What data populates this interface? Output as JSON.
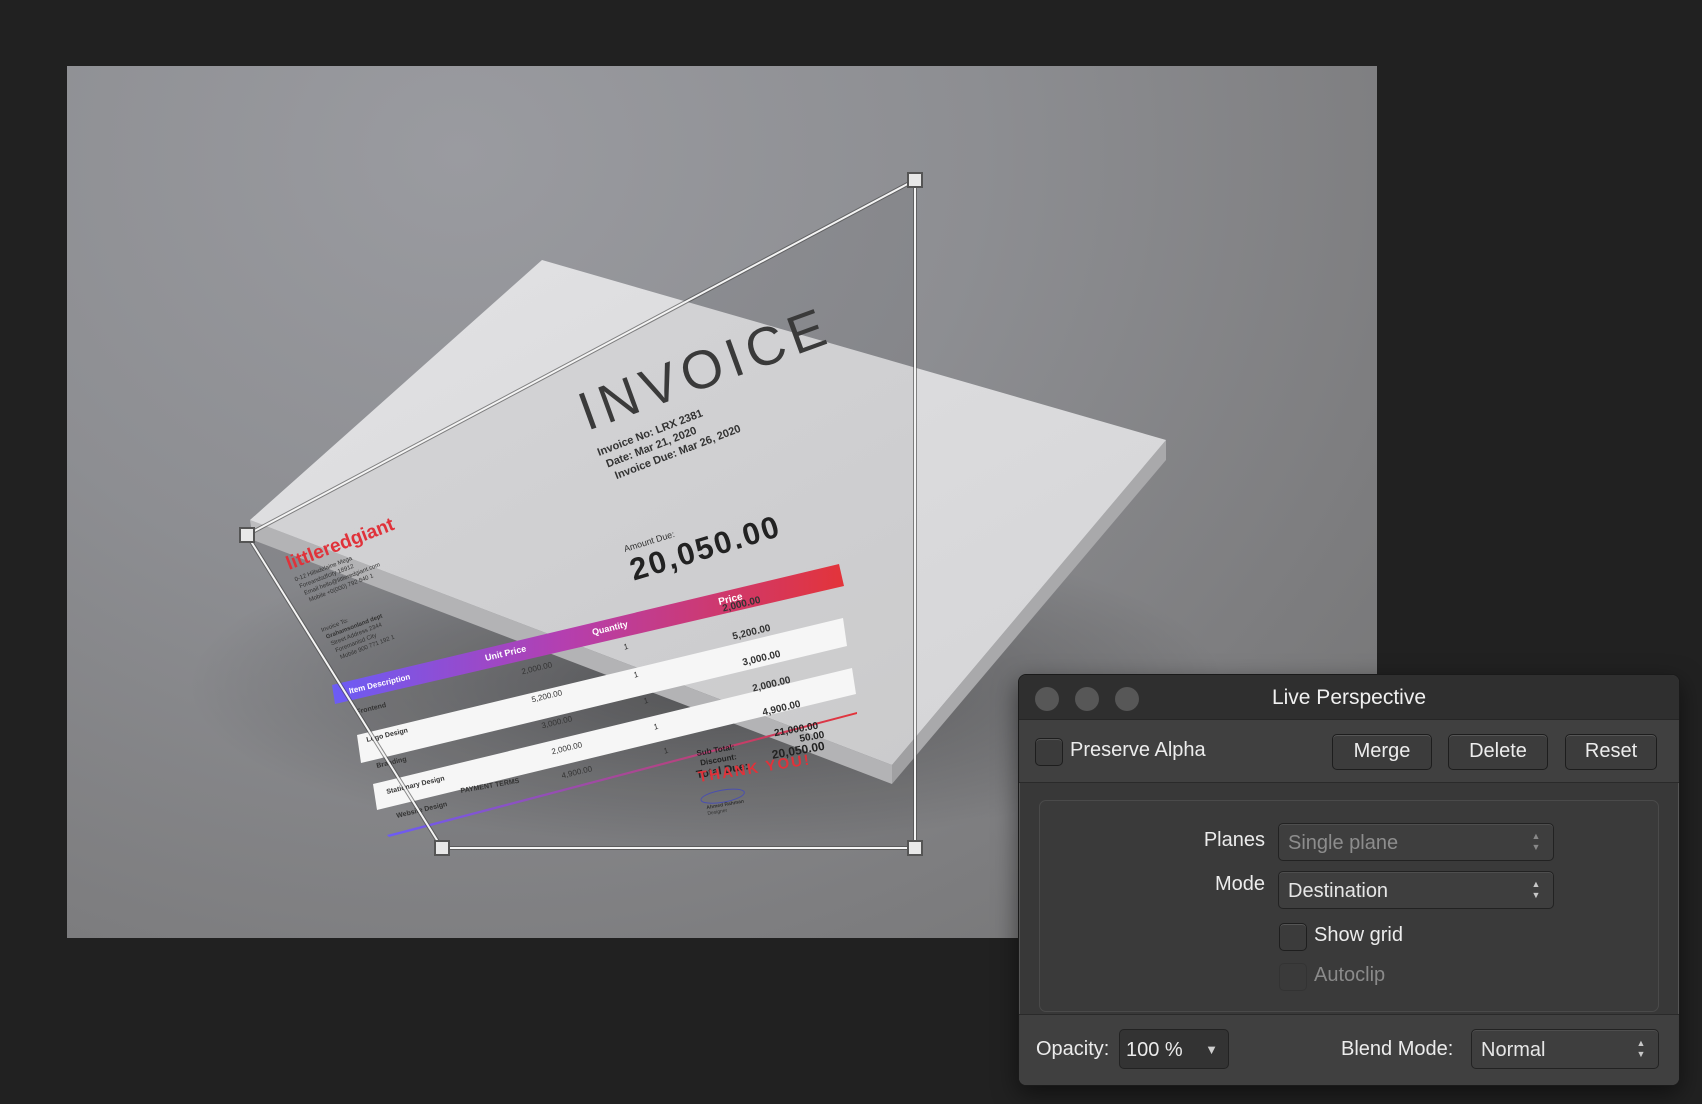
{
  "panel": {
    "title": "Live Perspective",
    "window_controls": [
      "close",
      "minimize",
      "zoom"
    ],
    "preserve_alpha": {
      "label": "Preserve Alpha",
      "checked": false
    },
    "buttons": {
      "merge": "Merge",
      "delete": "Delete",
      "reset": "Reset"
    },
    "planes": {
      "label": "Planes",
      "value": "Single plane",
      "enabled": false
    },
    "mode": {
      "label": "Mode",
      "value": "Destination"
    },
    "show_grid": {
      "label": "Show grid",
      "checked": false
    },
    "autoclip": {
      "label": "Autoclip",
      "checked": false,
      "enabled": false
    },
    "opacity": {
      "label": "Opacity:",
      "value": "100 %"
    },
    "blend_mode": {
      "label": "Blend Mode:",
      "value": "Normal"
    },
    "stepper_up": "▲",
    "stepper_down": "▼",
    "dropdown_caret": "▼"
  },
  "invoice": {
    "title": "INVOICE",
    "invoice_no": "Invoice No: LRX 2381",
    "date": "Date: Mar 21, 2020",
    "due": "Invoice Due:  Mar 26, 2020",
    "amount_due_label": "Amount Due:",
    "amount_due": "20,050.00",
    "brand": "littleredgiant",
    "brand_lines": [
      "0-12 Hillsdelaine Mega",
      "Foreandsdfcity 18912",
      "Email hello@littleredgiant.com",
      "Mobile +0(000) 792 840 1"
    ],
    "bill_to": [
      "Invoice To:",
      "Grahamsonland dept",
      "Street Address 2344",
      "Foremanlsd City",
      "Mobile 900 771 192 1"
    ],
    "headers": [
      "Item Description",
      "Unit Price",
      "Quantity",
      "Price"
    ],
    "rows": [
      {
        "item": "Frontend",
        "unit": "2,000.00",
        "qty": "1",
        "price": "2,000.00"
      },
      {
        "item": "Logo Design",
        "unit": "5,200.00",
        "qty": "1",
        "price": "5,200.00"
      },
      {
        "item": "Branding",
        "unit": "3,000.00",
        "qty": "1",
        "price": "3,000.00"
      },
      {
        "item": "Stationary Design",
        "unit": "2,000.00",
        "qty": "1",
        "price": "2,000.00"
      },
      {
        "item": "Website Design",
        "unit": "4,900.00",
        "qty": "1",
        "price": "4,900.00"
      }
    ],
    "sub_total_label": "Sub Total:",
    "sub_total": "21,000.00",
    "discount_label": "Discount:",
    "discount": "50.00",
    "total_label": "Total Due:",
    "total": "20,050.00",
    "thank_you": "THANK YOU!",
    "payment_terms": "PAYMENT TERMS",
    "signature_name": "Ahmed Rahman",
    "signature_role": "Designer"
  },
  "colors": {
    "accent_red": "#e0323a",
    "accent_purple": "#6b5cf6",
    "panel_bg": "#383838",
    "canvas_bg": "#212121"
  }
}
